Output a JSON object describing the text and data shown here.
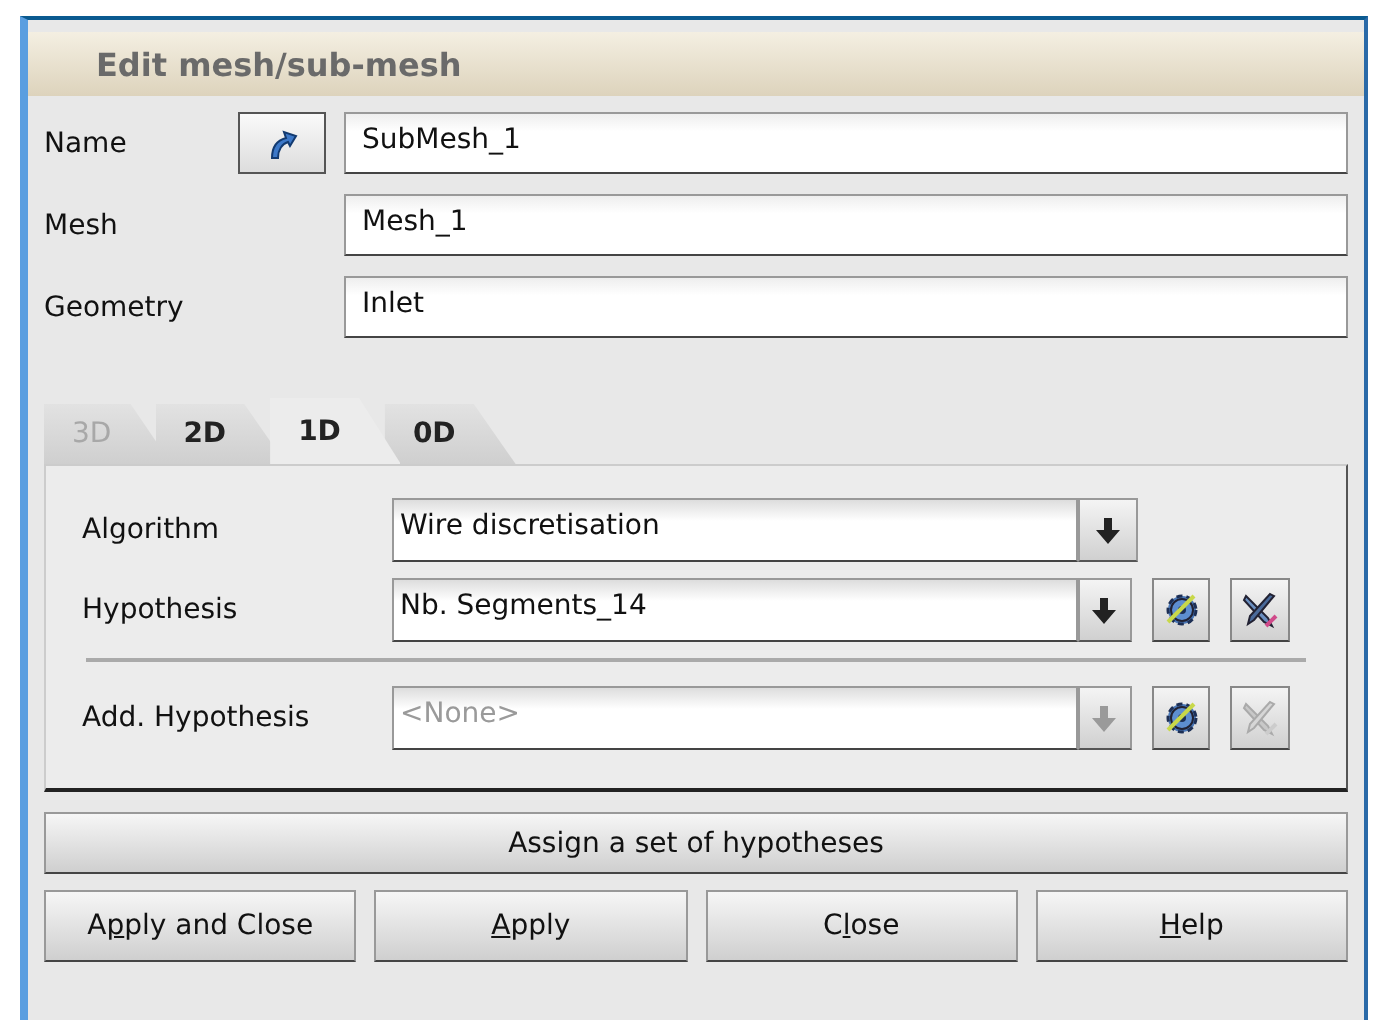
{
  "window": {
    "title": "Edit mesh/sub-mesh"
  },
  "fields": [
    {
      "kind": "with-picker",
      "label": "Name",
      "value": "SubMesh_1"
    },
    {
      "kind": "plain",
      "label": "Mesh",
      "value": "Mesh_1"
    },
    {
      "kind": "plain",
      "label": "Geometry",
      "value": "Inlet"
    }
  ],
  "tabs": [
    {
      "label": "3D",
      "selected": false,
      "disabled": true
    },
    {
      "label": "2D",
      "selected": false,
      "disabled": false
    },
    {
      "label": "1D",
      "selected": true,
      "disabled": false
    },
    {
      "label": "0D",
      "selected": false,
      "disabled": false
    }
  ],
  "rows": [
    {
      "kind": "combo",
      "label": "Algorithm",
      "value": "Wire discretisation",
      "disabled": false
    },
    {
      "kind": "combo",
      "label": "Hypothesis",
      "value": "Nb. Segments_14",
      "disabled": false,
      "tools": [
        {
          "kind": "create",
          "disabled": false
        },
        {
          "kind": "edit",
          "disabled": false
        }
      ]
    },
    {
      "kind": "separator"
    },
    {
      "kind": "combo",
      "label": "Add. Hypothesis",
      "value": "<None>",
      "disabled": true,
      "tools": [
        {
          "kind": "create",
          "disabled": false
        },
        {
          "kind": "edit",
          "disabled": true
        }
      ]
    }
  ],
  "assign_button": "Assign a set of hypotheses",
  "buttons": [
    {
      "before": "A",
      "key": "p",
      "after": "ply and Close"
    },
    {
      "key": "A",
      "after": "pply"
    },
    {
      "before": "C",
      "key": "l",
      "after": "ose"
    },
    {
      "key": "H",
      "after": "elp"
    }
  ]
}
